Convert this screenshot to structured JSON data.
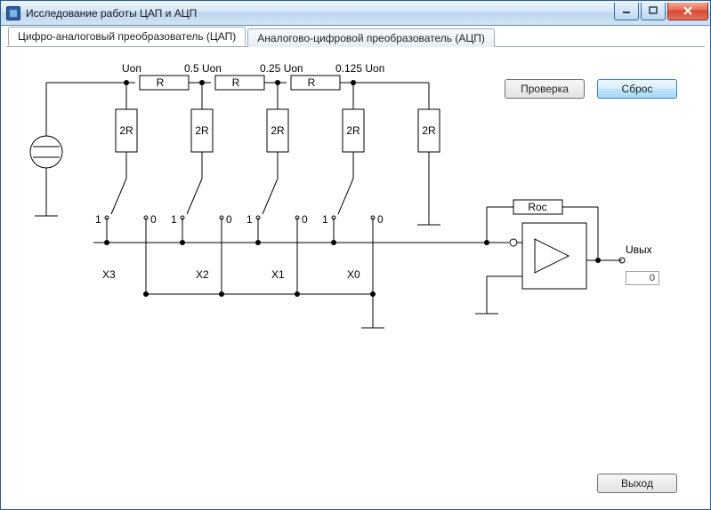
{
  "window": {
    "title": "Исследование работы ЦАП и АЦП"
  },
  "tabs": {
    "dac": "Цифро-аналоговый преобразователь (ЦАП)",
    "adc": "Аналогово-цифровой преобразователь (АЦП)"
  },
  "buttons": {
    "check": "Проверка",
    "reset": "Сброс",
    "exit": "Выход"
  },
  "circuit": {
    "top_labels": {
      "u": "Uоп",
      "u05": "0.5 Uоп",
      "u025": "0.25 Uоп",
      "u0125": "0.125 Uоп"
    },
    "r": "R",
    "r2": "2R",
    "roc": "Roc",
    "uout": "Uвых",
    "bits": {
      "x3": "X3",
      "x2": "X2",
      "x1": "X1",
      "x0": "X0"
    },
    "one": "1",
    "zero": "0"
  },
  "output_value": "0"
}
